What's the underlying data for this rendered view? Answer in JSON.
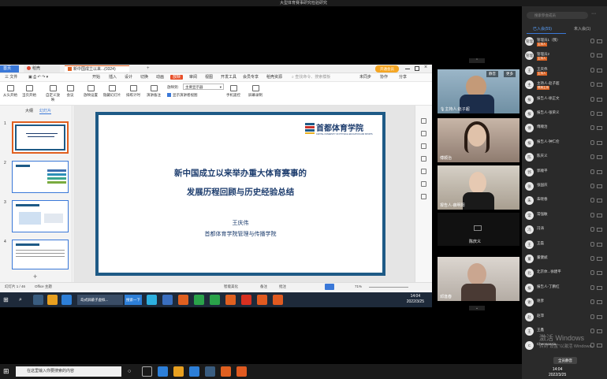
{
  "meeting": {
    "title": "大型体育赛事研究检验研究"
  },
  "wps": {
    "tabs": {
      "home": "首页",
      "daoke": "稻壳",
      "doc": "新中国成立以来...(0324)"
    },
    "menus": [
      "三 文件",
      "开始",
      "插入",
      "设计",
      "切换",
      "动画",
      "放映",
      "审阅",
      "视图",
      "开发工具",
      "会员专享",
      "稻壳资源"
    ],
    "active_menu": "放映",
    "search_placeholder": "查找命令、搜索模板",
    "ribbon": {
      "from_start": "从头开始",
      "from_current": "当页开始",
      "custom": "自定义放映",
      "meeting": "会议",
      "setup": "放映设置",
      "hide_slide": "隐藏幻灯片",
      "rehearse": "排练计时",
      "notes": "演讲备注",
      "monitor_label": "放映到:",
      "monitor_value": "主要显示器",
      "presenter_view": "显示演讲者视图",
      "phone_remote": "手机遥控",
      "record": "屏幕录制"
    },
    "left_tabs": {
      "outline": "大纲",
      "slides": "幻灯片"
    },
    "thumb_nums": [
      "1",
      "2",
      "3",
      "4"
    ],
    "status": {
      "slide_count": "幻灯片 1 / 46",
      "theme": "Office 主题",
      "smart_beautify": "智能美化",
      "notes": "备注",
      "comments": "批注",
      "zoom": "71%"
    },
    "right_top": {
      "share": "分享",
      "sync": "未同步",
      "collab": "协作"
    }
  },
  "slide": {
    "logo_cn": "首都体育学院",
    "logo_en": "CAPITAL UNIVERSITY OF PHYSICAL EDUCATION AND SPORTS",
    "title_line1": "新中国成立以来举办重大体育赛事的",
    "title_line2": "发展历程回顾与历史经验总结",
    "author": "王庆伟",
    "org": "首都体育学院管理与传播学院"
  },
  "inner_taskbar": {
    "item1": "岛式屏蔽子虚拟...",
    "item2": "搜索一下",
    "time": "14:04",
    "date": "2022/3/25"
  },
  "videos": [
    {
      "name": "主持人:赵子超",
      "btn1": "静音",
      "btn2": "更多"
    },
    {
      "name": "傅顺治"
    },
    {
      "name": "报告人-薛明阳"
    },
    {
      "name": "陈庆义"
    },
    {
      "name": "邓逢春"
    }
  ],
  "participants": {
    "search_placeholder": "搜索参会成员",
    "tab_in": "已入会(55)",
    "tab_out": "未入会(1)",
    "list": [
      {
        "avatar": "管理",
        "name": "管理员1（我）",
        "role": "主持人"
      },
      {
        "avatar": "管理",
        "name": "管理员2",
        "role": "主持人"
      },
      {
        "avatar": "王",
        "name": "王庆伟",
        "role": "主持人"
      },
      {
        "avatar": "主",
        "name": "主持人-赵子超",
        "role": "联席主持"
      },
      {
        "avatar": "报",
        "name": "报告人-徐正文",
        "role": ""
      },
      {
        "avatar": "报",
        "name": "报告人-张荣义",
        "role": ""
      },
      {
        "avatar": "傅",
        "name": "傅顺治",
        "role": ""
      },
      {
        "avatar": "报",
        "name": "报告人-钟仁伦",
        "role": ""
      },
      {
        "avatar": "陈",
        "name": "陈庆义",
        "role": ""
      },
      {
        "avatar": "郭",
        "name": "郭顺平",
        "role": ""
      },
      {
        "avatar": "张",
        "name": "张国庆",
        "role": ""
      },
      {
        "avatar": "朱",
        "name": "朱晓春",
        "role": ""
      },
      {
        "avatar": "常",
        "name": "常强敏",
        "role": ""
      },
      {
        "avatar": "冯",
        "name": "冯涛",
        "role": ""
      },
      {
        "avatar": "王",
        "name": "王磊",
        "role": ""
      },
      {
        "avatar": "董",
        "name": "董健斌",
        "role": ""
      },
      {
        "avatar": "北",
        "name": "北京体...徐建平",
        "role": ""
      },
      {
        "avatar": "报",
        "name": "报告人-丁鹏红",
        "role": ""
      },
      {
        "avatar": "谢",
        "name": "谢彦",
        "role": ""
      },
      {
        "avatar": "赵",
        "name": "赵萍",
        "role": ""
      },
      {
        "avatar": "王",
        "name": "王鑫",
        "role": ""
      },
      {
        "avatar": "C",
        "name": "Chennanaiu",
        "role": ""
      }
    ],
    "mute_all": "全员静音"
  },
  "taskbar": {
    "search_placeholder": "在这里输入你要搜索的内容",
    "time": "14:04",
    "date": "2022/3/25"
  },
  "watermark": {
    "line1": "激活 Windows",
    "line2": "转到\"设置\"以激活 Windows。"
  }
}
